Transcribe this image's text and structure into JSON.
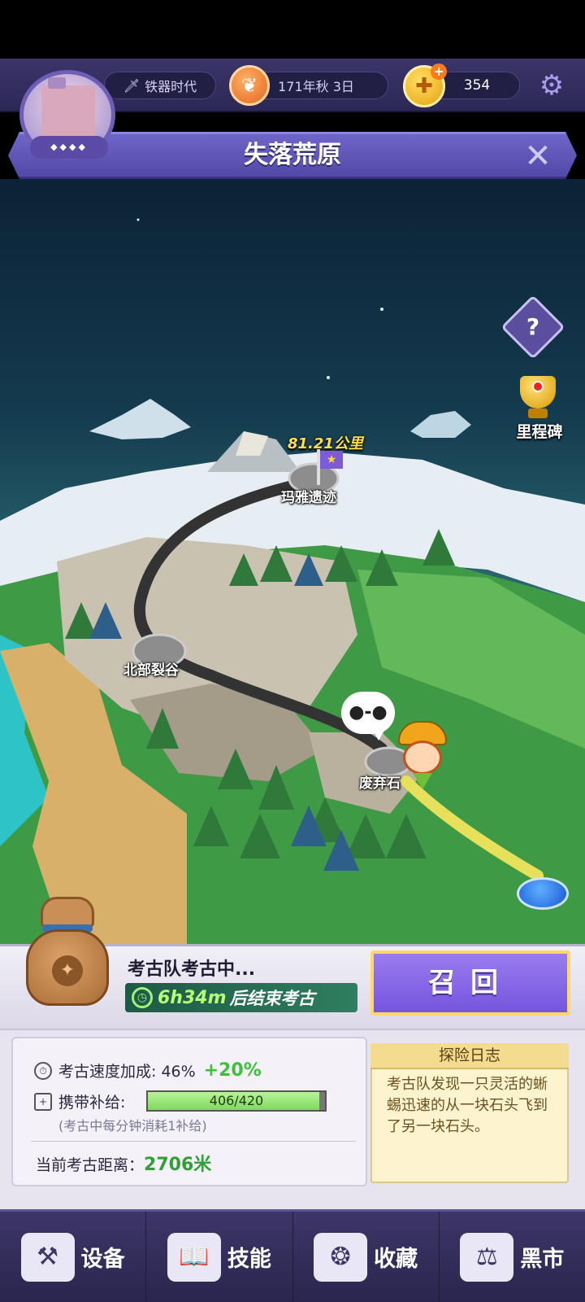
{
  "hud": {
    "era": "铁器时代",
    "date": "171年秋 3日",
    "coins": "354",
    "icons": {
      "era": "sword-icon",
      "leaf": "leaf-icon",
      "coin": "coin-icon",
      "settings": "gear-icon"
    }
  },
  "banner": {
    "title": "失落荒原"
  },
  "map": {
    "milestone_label": "里程碑",
    "distance_label": "81.21公里",
    "locations": {
      "maya_ruins": "玛雅遗迹",
      "north_rift": "北部裂谷",
      "abandoned_rock": "废弃石"
    },
    "speech_bubble": "●-●",
    "help_symbol": "?"
  },
  "status": {
    "digging_text": "考古队考古中...",
    "timer_value": "6h34m",
    "timer_suffix": "后结束考古",
    "recall_label": "召回"
  },
  "stats": {
    "speed_label": "考古速度加成: 46%",
    "speed_bonus": "+20%",
    "supply_label": "携带补给:",
    "supply_value": "406/420",
    "supply_fraction": 0.967,
    "supply_note": "(考古中每分钟消耗1补给)",
    "distance_label": "当前考古距离：",
    "distance_value": "2706米"
  },
  "log": {
    "title": "探险日志",
    "text": "考古队发现一只灵活的蜥蜴迅速的从一块石头飞到了另一块石头。"
  },
  "nav": {
    "items": [
      {
        "label": "设备",
        "icon": "anvil-icon"
      },
      {
        "label": "技能",
        "icon": "book-icon"
      },
      {
        "label": "收藏",
        "icon": "treasure-icon"
      },
      {
        "label": "黑市",
        "icon": "shop-icon"
      }
    ]
  }
}
